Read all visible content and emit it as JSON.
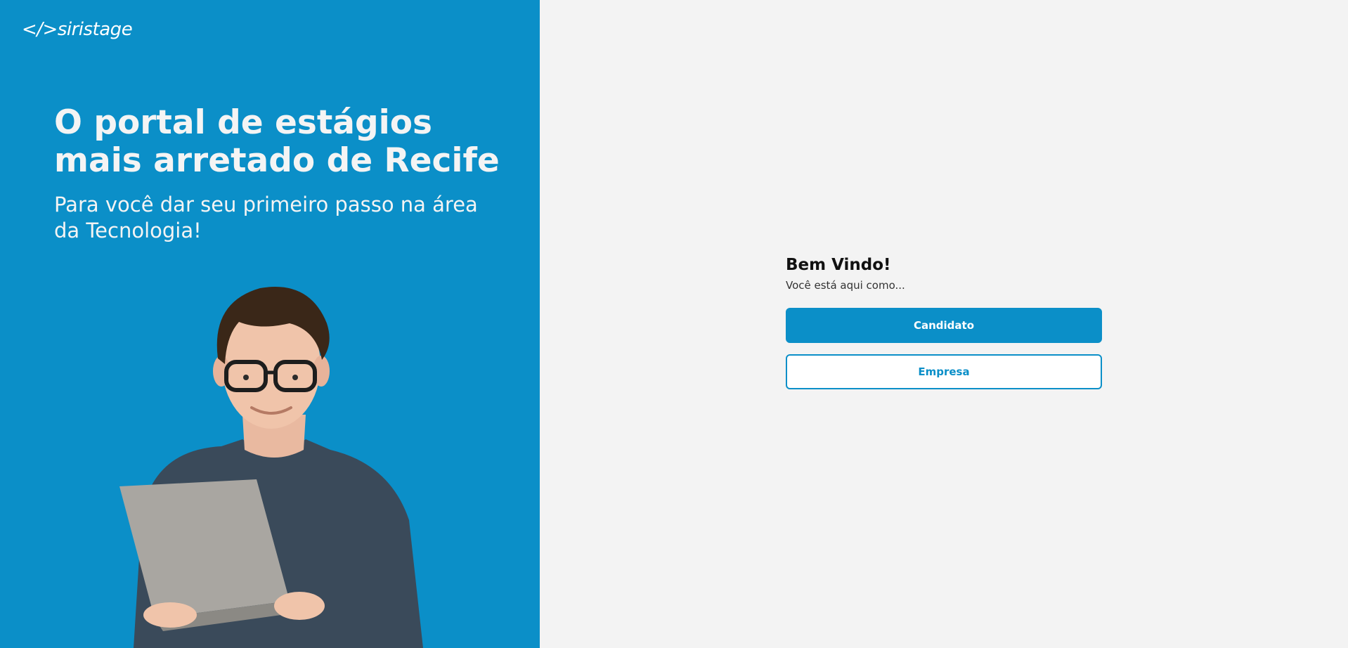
{
  "brand": {
    "logo_text": "</>siristage"
  },
  "hero": {
    "title": "O portal de estágios mais arretado de Recife",
    "subtitle": "Para você dar seu primeiro passo na área da Tecnologia!"
  },
  "welcome": {
    "title": "Bem Vindo!",
    "subtitle": "Você está aqui como...",
    "candidate_button": "Candidato",
    "company_button": "Empresa"
  },
  "colors": {
    "brand_blue": "#0b8fc8",
    "panel_background": "#f3f3f3",
    "hero_text": "#f4f4f4"
  }
}
